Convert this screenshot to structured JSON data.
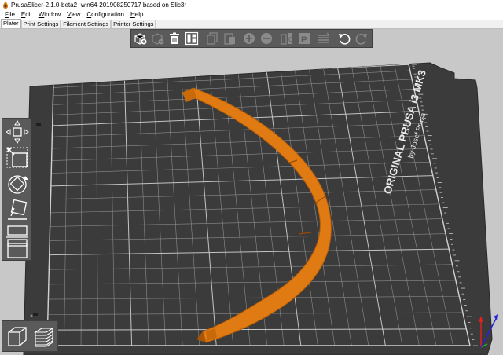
{
  "window": {
    "title": "PrusaSlicer-2.1.0-beta2+win64-201908250717 based on Slic3r"
  },
  "menu": [
    {
      "ul": "F",
      "rest": "ile"
    },
    {
      "ul": "E",
      "rest": "dit"
    },
    {
      "ul": "W",
      "rest": "indow"
    },
    {
      "ul": "V",
      "rest": "iew"
    },
    {
      "ul": "C",
      "rest": "onfiguration"
    },
    {
      "ul": "H",
      "rest": "elp"
    }
  ],
  "tabs": [
    {
      "label": "Plater",
      "active": true
    },
    {
      "label": "Print Settings",
      "active": false
    },
    {
      "label": "Filament Settings",
      "active": false
    },
    {
      "label": "Printer Settings",
      "active": false
    }
  ],
  "toolbar": {
    "buttons": [
      {
        "icon": "add-icon",
        "enabled": true
      },
      {
        "icon": "delete-icon",
        "enabled": false
      },
      {
        "icon": "delete-all-icon",
        "enabled": true
      },
      {
        "icon": "arrange-icon",
        "enabled": true
      },
      {
        "icon": "copy-icon",
        "enabled": false
      },
      {
        "icon": "paste-icon",
        "enabled": false
      },
      {
        "icon": "add-instance-icon",
        "enabled": false
      },
      {
        "icon": "remove-instance-icon",
        "enabled": false
      },
      {
        "icon": "split-objects-icon",
        "enabled": false
      },
      {
        "icon": "split-parts-icon",
        "enabled": false
      },
      {
        "icon": "layers-editing-icon",
        "enabled": false
      },
      {
        "icon": "undo-icon",
        "enabled": true
      },
      {
        "icon": "redo-icon",
        "enabled": false
      }
    ]
  },
  "gizmos": [
    "move-icon",
    "scale-icon",
    "rotate-icon",
    "place-on-face-icon",
    "cut-icon",
    "sla-supports-icon"
  ],
  "bed": {
    "printer_name": "ORIGINAL PRUSA i3 MK3",
    "maker": "by Josef Prusa"
  },
  "colors": {
    "viewport_bg": "#c8c8c8",
    "bed": "#3b3b3b",
    "grid": "#9a9a9a",
    "object": "#e07a12",
    "toolbar": "#5a5a5a"
  },
  "view_buttons": [
    "3d-view-icon",
    "layers-preview-icon"
  ]
}
